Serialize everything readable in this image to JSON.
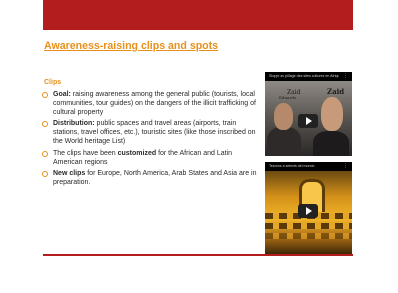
{
  "slide": {
    "title": "Awareness-raising clips and spots",
    "subheading": "Clips",
    "bullets": [
      {
        "bold_lead": "Goal:",
        "text": " raising awareness among the general public (tourists, local communities, tour guides) on the dangers of the illicit trafficking of cultural property"
      },
      {
        "bold_lead": "Distribution:",
        "text": " public spaces and travel areas (airports, train stations, travel offices, etc.), touristic sites (like those inscribed on the World heritage List)"
      },
      {
        "text_before": "The clips have been ",
        "bold_mid": "customized",
        "text_after": " for the African and Latin American regions"
      },
      {
        "bold_lead": "New clips",
        "text": " for Europe, North America, Arab States and Asia are in preparation."
      }
    ],
    "colors": {
      "accent_red": "#b41d1d",
      "title_orange": "#e8901c",
      "body_text": "#2b2b2b"
    }
  },
  "videos": [
    {
      "caption": "Stoppt av pillage des sites cultures en Afrique",
      "menu_glyph": "⋮",
      "scene_words": [
        "Zaid",
        "Eduardo",
        "Zaid"
      ],
      "play_icon": "play-icon"
    },
    {
      "caption": "Tesoros a selects del mundo",
      "menu_glyph": "⋮",
      "play_icon": "play-icon"
    }
  ]
}
